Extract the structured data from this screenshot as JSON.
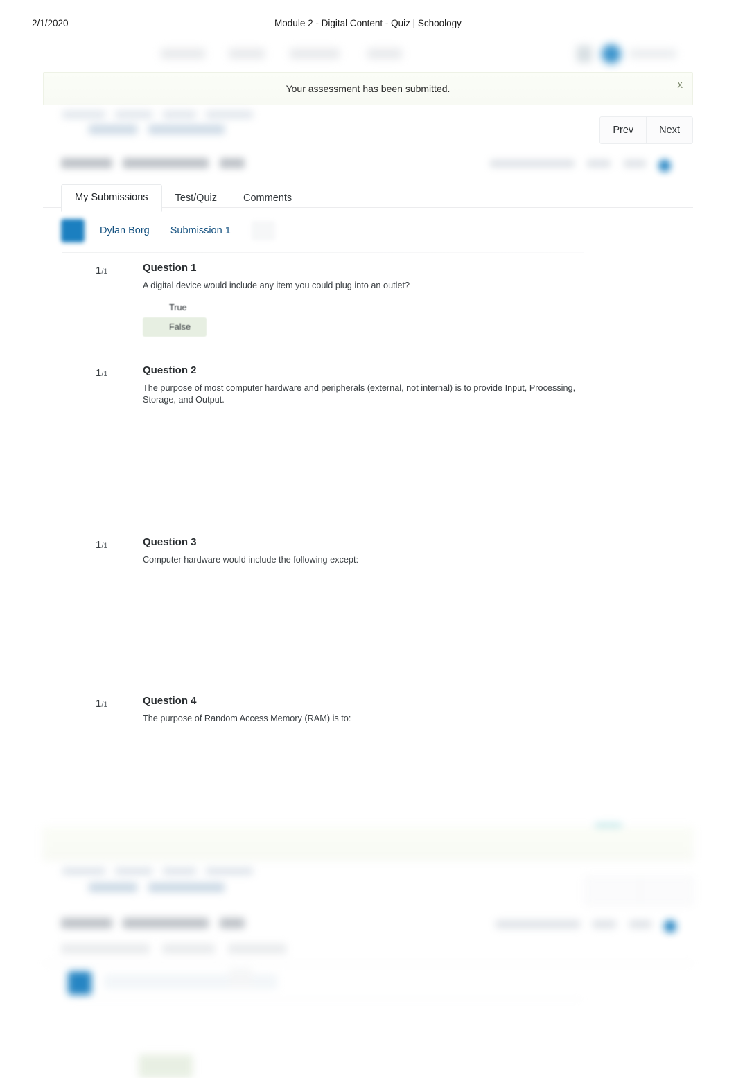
{
  "print": {
    "date": "2/1/2020",
    "title": "Module 2 - Digital Content - Quiz | Schoology"
  },
  "alert": {
    "message": "Your assessment has been submitted.",
    "close_label": "X"
  },
  "pager": {
    "prev_label": "Prev",
    "next_label": "Next"
  },
  "tabs": [
    {
      "label": "My Submissions",
      "active": true
    },
    {
      "label": "Test/Quiz",
      "active": false
    },
    {
      "label": "Comments",
      "active": false
    }
  ],
  "submission": {
    "student_name": "Dylan Borg",
    "attempt_label": "Submission 1"
  },
  "questions": [
    {
      "score": "1",
      "out_of": "/1",
      "title": "Question 1",
      "text": "A digital device would include any item you could plug into an outlet?",
      "choices": [
        {
          "label": "True",
          "state": "unselected"
        },
        {
          "label": "False",
          "state": "correct"
        }
      ]
    },
    {
      "score": "1",
      "out_of": "/1",
      "title": "Question 2",
      "text": "The purpose of most computer hardware and peripherals (external, not internal) is to provide Input, Processing, Storage, and Output.",
      "choices": []
    },
    {
      "score": "1",
      "out_of": "/1",
      "title": "Question 3",
      "text": "Computer hardware would include the following except:",
      "choices": []
    },
    {
      "score": "1",
      "out_of": "/1",
      "title": "Question 4",
      "text": "The purpose of Random Access Memory (RAM) is to:",
      "choices": []
    }
  ],
  "colors": {
    "link": "#13507f",
    "avatar": "#1b7fc0",
    "correct_highlight": "#e7efe2",
    "alert_background": "#f9fbf5",
    "text": "#3b4044"
  }
}
